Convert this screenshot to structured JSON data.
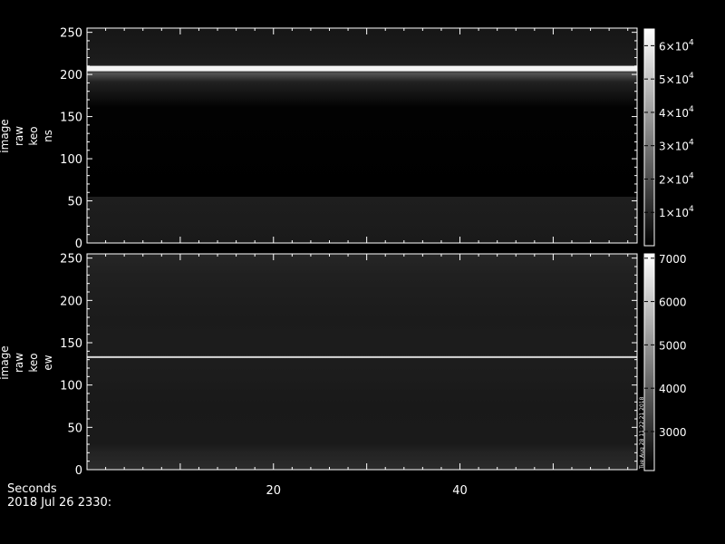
{
  "chart_data": [
    {
      "type": "heatmap",
      "ylabel_lines": [
        "image",
        "raw",
        "keo",
        "ns"
      ],
      "y_ticks": [
        "0",
        "50",
        "100",
        "150",
        "200",
        "250"
      ],
      "ylim": [
        0,
        255
      ],
      "xlim": [
        0,
        59
      ],
      "zlim": [
        0,
        65000
      ],
      "colorbar_ticks": [
        {
          "value": 10000,
          "base": "1×10",
          "exp": "4"
        },
        {
          "value": 20000,
          "base": "2×10",
          "exp": "4"
        },
        {
          "value": 30000,
          "base": "3×10",
          "exp": "4"
        },
        {
          "value": 40000,
          "base": "4×10",
          "exp": "4"
        },
        {
          "value": 50000,
          "base": "5×10",
          "exp": "4"
        },
        {
          "value": 60000,
          "base": "6×10",
          "exp": "4"
        }
      ],
      "colormap": "grayscale",
      "bright_line_row": 207,
      "bands": [
        {
          "rows": [
            0,
            55
          ],
          "level": "low"
        },
        {
          "rows": [
            55,
            170
          ],
          "level": "dark"
        },
        {
          "rows": [
            170,
            213
          ],
          "level": "bright"
        },
        {
          "rows": [
            213,
            255
          ],
          "level": "low"
        }
      ]
    },
    {
      "type": "heatmap",
      "ylabel_lines": [
        "image",
        "raw",
        "keo",
        "ew"
      ],
      "y_ticks": [
        "0",
        "50",
        "100",
        "150",
        "200",
        "250"
      ],
      "ylim": [
        0,
        255
      ],
      "xlim": [
        0,
        59
      ],
      "zlim": [
        2100,
        7100
      ],
      "colorbar_ticks": [
        {
          "value": 3000,
          "label": "3000"
        },
        {
          "value": 4000,
          "label": "4000"
        },
        {
          "value": 5000,
          "label": "5000"
        },
        {
          "value": 6000,
          "label": "6000"
        },
        {
          "value": 7000,
          "label": "7000"
        }
      ],
      "colormap": "grayscale",
      "bright_line_row": 133,
      "colorbar_side_text": "Tue Aug 28 11:22:21 2018"
    }
  ],
  "x_axis": {
    "ticks": [
      {
        "value": 20,
        "label": "20"
      },
      {
        "value": 40,
        "label": "40"
      }
    ],
    "label": "Seconds",
    "date_label": "2018 Jul 26 2330:"
  }
}
